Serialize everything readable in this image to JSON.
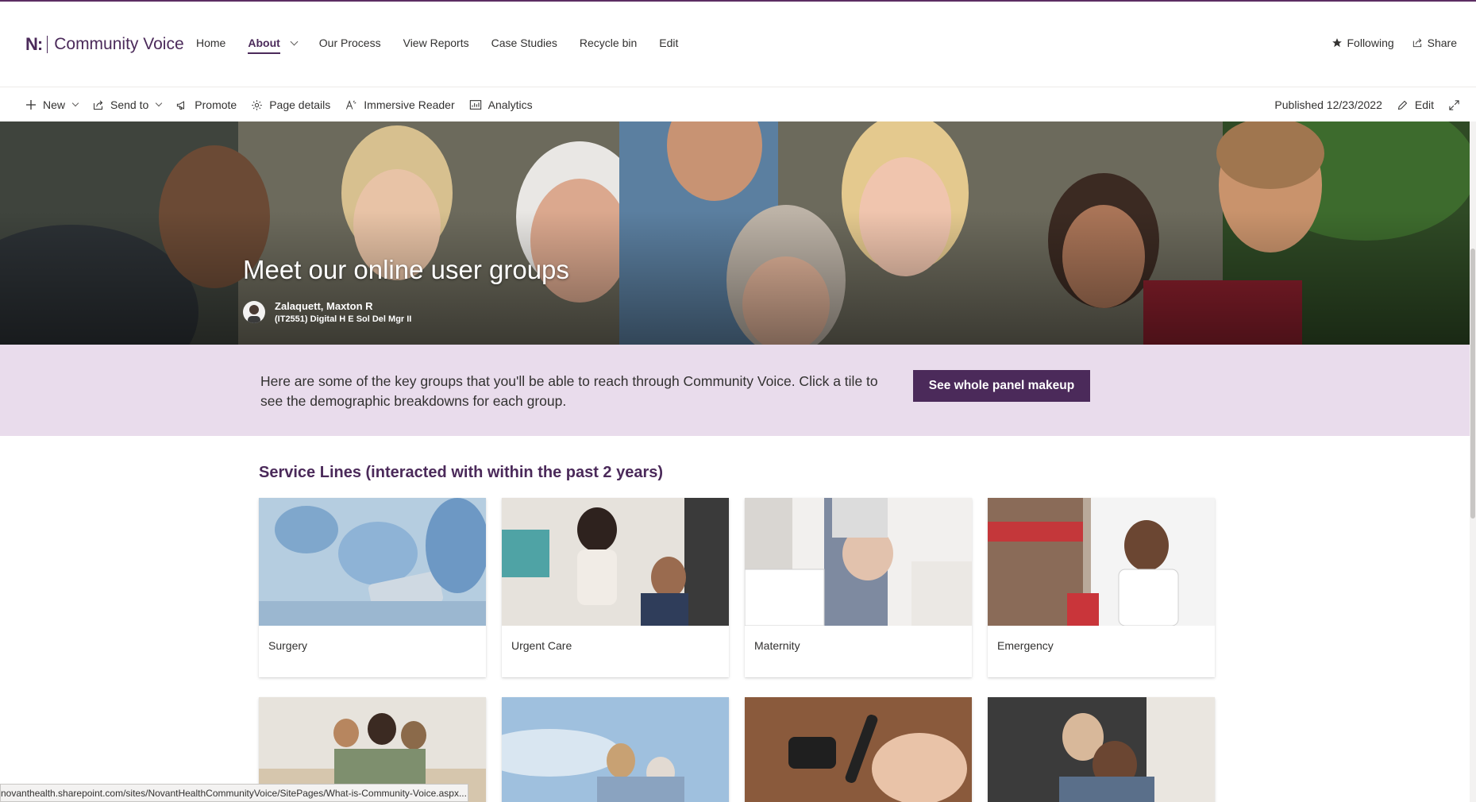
{
  "site": {
    "logo_mark": "N:",
    "logo_text_1": "Community",
    "logo_text_2": "Voice"
  },
  "nav": {
    "items": [
      {
        "label": "Home"
      },
      {
        "label": "About",
        "active": true,
        "has_dropdown": true
      },
      {
        "label": "Our Process"
      },
      {
        "label": "View Reports"
      },
      {
        "label": "Case Studies"
      },
      {
        "label": "Recycle bin"
      },
      {
        "label": "Edit"
      }
    ]
  },
  "header_actions": {
    "following_label": "Following",
    "share_label": "Share"
  },
  "command_bar": {
    "new_label": "New",
    "send_to_label": "Send to",
    "promote_label": "Promote",
    "page_details_label": "Page details",
    "immersive_reader_label": "Immersive Reader",
    "analytics_label": "Analytics",
    "published_label": "Published 12/23/2022",
    "edit_label": "Edit"
  },
  "hero": {
    "title": "Meet our online user groups",
    "author_name": "Zalaquett, Maxton R",
    "author_title": "(IT2551) Digital H E Sol Del Mgr II"
  },
  "intro": {
    "text": "Here are some of the key groups that you'll be able to reach through Community Voice. Click a tile to see the demographic breakdowns for each group.",
    "button_label": "See whole panel makeup"
  },
  "section": {
    "title": "Service Lines (interacted with within the past 2 years)",
    "tiles": [
      {
        "label": "Surgery"
      },
      {
        "label": "Urgent Care"
      },
      {
        "label": "Maternity"
      },
      {
        "label": "Emergency"
      }
    ]
  },
  "status_bar": {
    "url": "novanthealth.sharepoint.com/sites/NovantHealthCommunityVoice/SitePages/What-is-Community-Voice.aspx..."
  },
  "colors": {
    "brand": "#4b2a5a",
    "intro_band": "#e9dcec"
  }
}
